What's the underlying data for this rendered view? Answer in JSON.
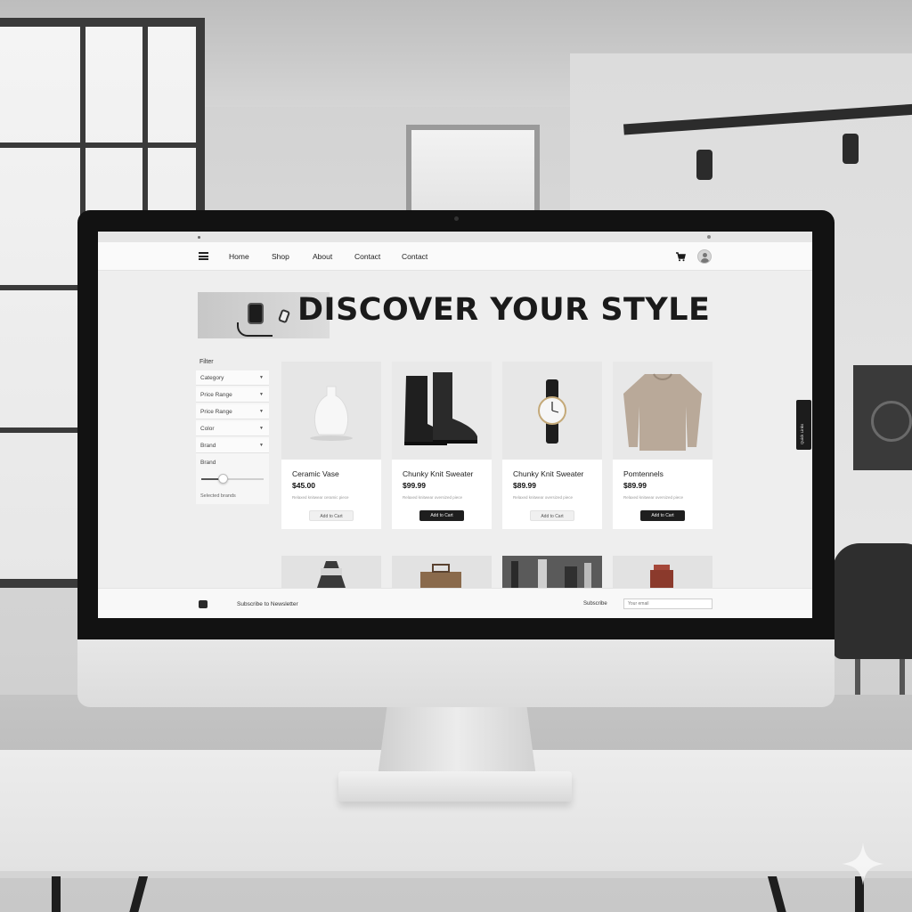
{
  "nav": {
    "links": [
      "Home",
      "Shop",
      "About",
      "Contact",
      "Contact"
    ]
  },
  "hero": {
    "title": "DISCOVER YOUR STYLE"
  },
  "filter": {
    "title": "Filter",
    "rows": [
      "Category",
      "Price Range",
      "Price Range",
      "Color",
      "Brand"
    ],
    "brand_label": "Brand",
    "selected_label": "Selected brands",
    "slider_value": 0.35
  },
  "products": [
    {
      "name": "Ceramic Vase",
      "price": "$45.00",
      "desc": "Relaxed knitwear ceramic piece",
      "button": "Add to Cart"
    },
    {
      "name": "Chunky Knit Sweater",
      "price": "$99.99",
      "desc": "Relaxed knitwear oversized piece",
      "button": "Add to Cart"
    },
    {
      "name": "Chunky Knit Sweater",
      "price": "$89.99",
      "desc": "Relaxed knitwear oversized piece",
      "button": "Add to Cart"
    },
    {
      "name": "Pomtennels",
      "price": "$89.99",
      "desc": "Relaxed knitwear oversized piece",
      "button": "Add to Cart"
    }
  ],
  "footer": {
    "subscribe": "Subscribe to Newsletter",
    "label": "Subscribe",
    "placeholder": "Your email"
  },
  "side_tab": "Quick Links",
  "colors": {
    "accent": "#1e1e1e",
    "page_bg": "#eeeeee"
  }
}
